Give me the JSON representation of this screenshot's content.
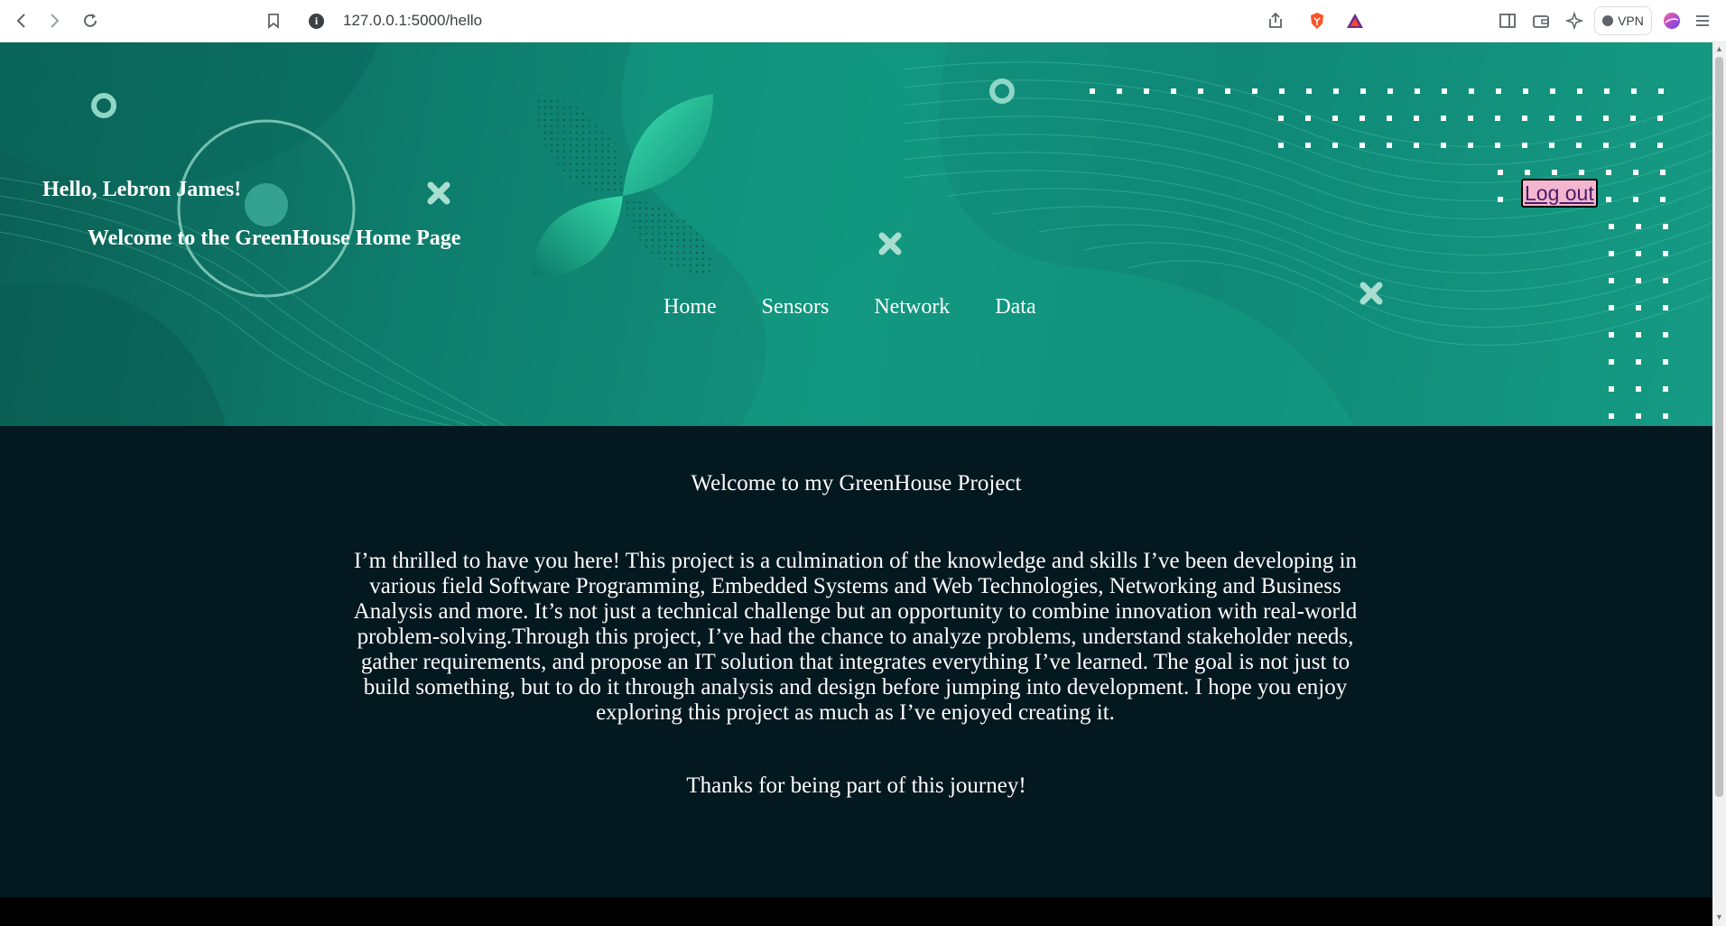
{
  "browser": {
    "url": "127.0.0.1:5000/hello",
    "vpn_label": "VPN"
  },
  "header": {
    "greeting": "Hello, Lebron James!",
    "welcome": "Welcome to the GreenHouse Home Page",
    "logout_label": "Log out",
    "nav": {
      "home": "Home",
      "sensors": "Sensors",
      "network": "Network",
      "data": "Data"
    }
  },
  "main": {
    "title": "Welcome to my GreenHouse Project",
    "body": "I’m thrilled to have you here! This project is a culmination of the knowledge and skills I’ve been developing in various field Software Programming, Embedded Systems and Web Technologies, Networking and Business Analysis and more. It’s not just a technical challenge but an opportunity to combine innovation with real-world problem-solving.Through this project, I’ve had the chance to analyze problems, understand stakeholder needs, gather requirements, and propose an IT solution that integrates everything I’ve learned. The goal is not just to build something, but to do it through analysis and design before jumping into development. I hope you enjoy exploring this project as much as I’ve enjoyed creating it.",
    "thanks": "Thanks for being part of this journey!"
  },
  "colors": {
    "hero_green": "#12917c",
    "content_bg": "#041820",
    "logout_bg": "#f4b6cf"
  },
  "icons": [
    "back-icon",
    "forward-icon",
    "reload-icon",
    "bookmark-icon",
    "site-info-icon",
    "share-icon",
    "brave-shield-icon",
    "brave-rewards-icon",
    "sidebar-icon",
    "wallet-icon",
    "leo-ai-icon",
    "vpn-icon",
    "profile-icon",
    "menu-icon"
  ]
}
